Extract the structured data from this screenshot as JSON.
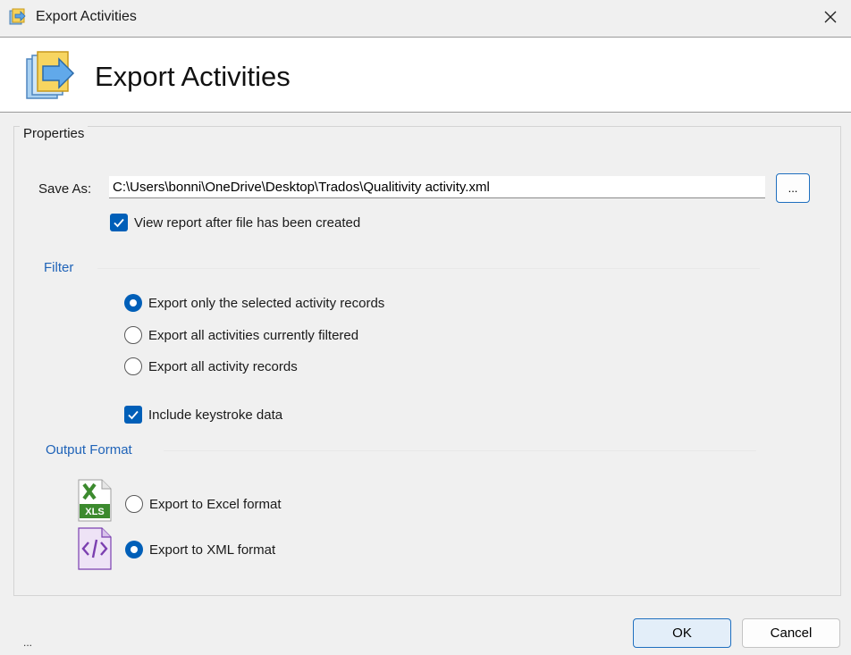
{
  "window": {
    "title": "Export Activities",
    "close_icon": "close-icon"
  },
  "header": {
    "heading": "Export Activities",
    "icon": "export-activities-icon"
  },
  "properties": {
    "legend": "Properties",
    "save_as_label": "Save As:",
    "save_as_value": "C:\\Users\\bonni\\OneDrive\\Desktop\\Trados\\Qualitivity activity.xml",
    "browse_label": "...",
    "view_report_label": "View report after file has been created",
    "view_report_checked": true
  },
  "filter": {
    "title": "Filter",
    "options": [
      {
        "label": "Export only the selected activity records",
        "selected": true
      },
      {
        "label": "Export all activities currently filtered",
        "selected": false
      },
      {
        "label": "Export all activity records",
        "selected": false
      }
    ],
    "include_keystroke_label": "Include keystroke data",
    "include_keystroke_checked": true
  },
  "output_format": {
    "title": "Output Format",
    "options": [
      {
        "label": "Export to Excel format",
        "selected": false,
        "icon": "excel-file-icon",
        "icon_text": "XLS"
      },
      {
        "label": "Export to XML format",
        "selected": true,
        "icon": "xml-file-icon",
        "icon_text": "</>"
      }
    ]
  },
  "footer": {
    "ok_label": "OK",
    "cancel_label": "Cancel",
    "status_text": "..."
  },
  "colors": {
    "accent": "#005fb8",
    "section_title": "#1f63b8",
    "excel_green": "#3c8a2e",
    "xml_purple": "#7b3fb0"
  }
}
